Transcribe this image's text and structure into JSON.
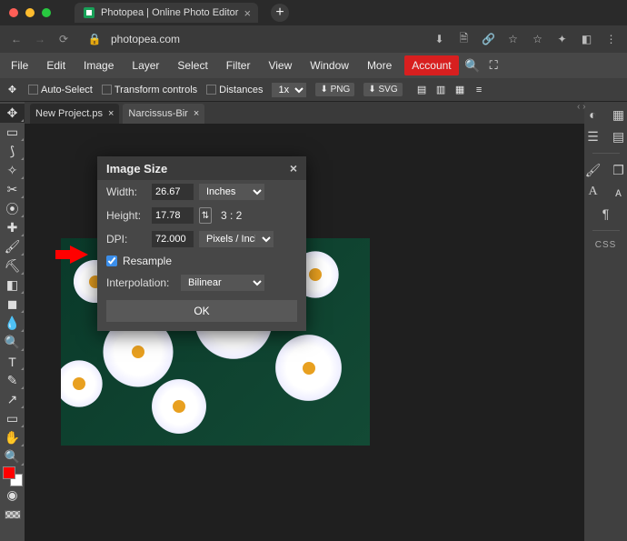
{
  "titlebar": {
    "tab_title": "Photopea | Online Photo Editor",
    "favicon": "photopea-icon"
  },
  "urlbar": {
    "url": "photopea.com"
  },
  "menu": {
    "items": [
      "File",
      "Edit",
      "Image",
      "Layer",
      "Select",
      "Filter",
      "View",
      "Window",
      "More"
    ],
    "account": "Account"
  },
  "optbar": {
    "auto_select": "Auto-Select",
    "transform": "Transform controls",
    "distances": "Distances",
    "zoom": "1x",
    "png": "PNG",
    "svg": "SVG"
  },
  "doc_tabs": [
    {
      "name": "New Project.ps"
    },
    {
      "name": "Narcissus-Bir"
    }
  ],
  "dialog": {
    "title": "Image Size",
    "width_label": "Width:",
    "width_val": "26.67",
    "height_label": "Height:",
    "height_val": "17.78",
    "ratio": "3 : 2",
    "dpi_label": "DPI:",
    "dpi_val": "72.000",
    "units": "Inches",
    "dpi_units": "Pixels / Inch",
    "resample": "Resample",
    "resample_checked": true,
    "interp_label": "Interpolation:",
    "interp": "Bilinear",
    "ok": "OK"
  },
  "rpanel": {
    "css_label": "CSS"
  },
  "colors": {
    "accent": "#d81f1f",
    "toolbar": "#474747"
  }
}
